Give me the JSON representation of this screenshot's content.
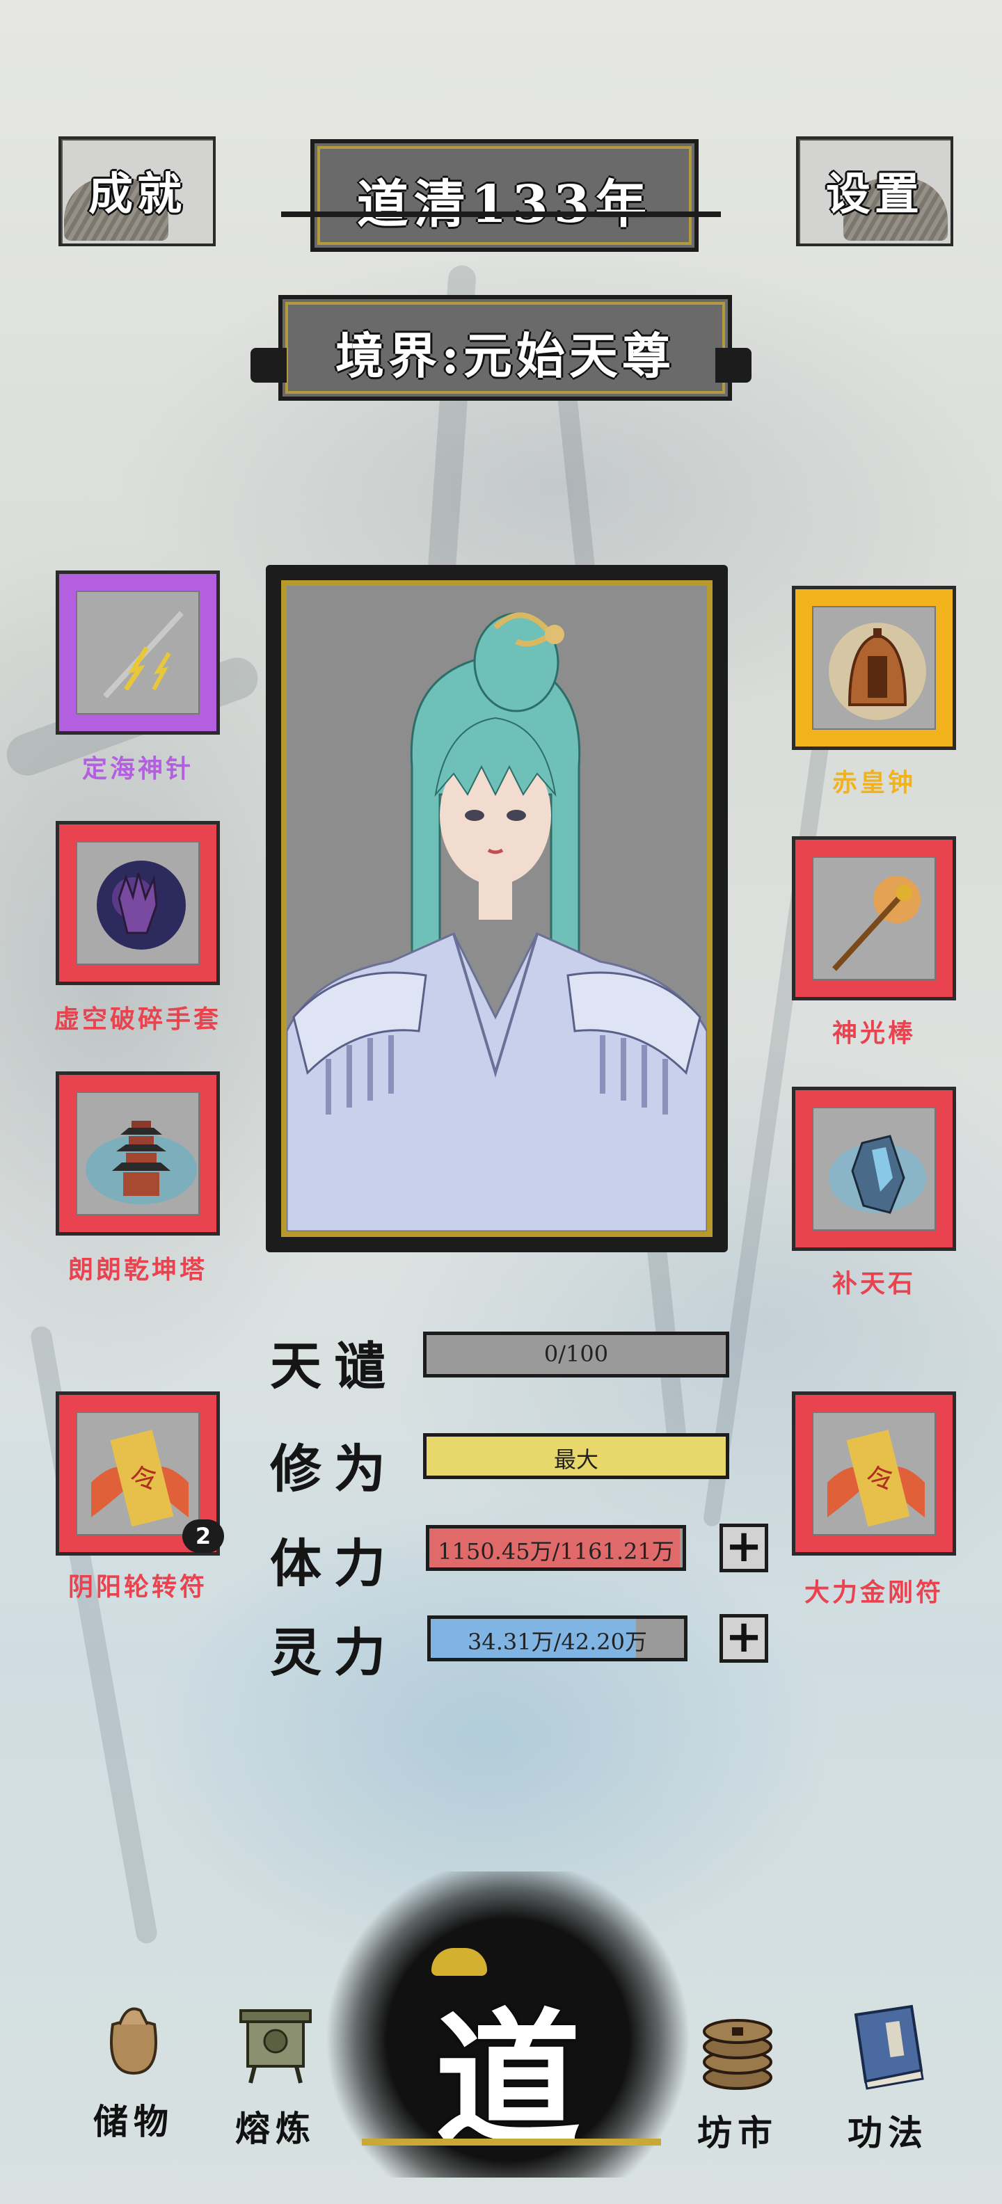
{
  "header": {
    "achievements_label": "成就",
    "era": "道清133年",
    "settings_label": "设置",
    "realm": "境界:元始天尊"
  },
  "equipment": {
    "left": [
      {
        "name": "定海神针",
        "rarity_color": "#b45ee0",
        "icon": "spear-icon"
      },
      {
        "name": "虚空破碎手套",
        "rarity_color": "#e8434f",
        "icon": "gauntlet-icon"
      },
      {
        "name": "朗朗乾坤塔",
        "rarity_color": "#e8434f",
        "icon": "pagoda-icon"
      },
      {
        "name": "阴阳轮转符",
        "rarity_color": "#e8434f",
        "icon": "talisman-icon",
        "count": "2"
      }
    ],
    "right": [
      {
        "name": "赤皇钟",
        "rarity_color": "#f2b21c",
        "icon": "bell-icon"
      },
      {
        "name": "神光棒",
        "rarity_color": "#e8434f",
        "icon": "staff-icon"
      },
      {
        "name": "补天石",
        "rarity_color": "#e8434f",
        "icon": "crystal-stone-icon"
      },
      {
        "name": "大力金刚符",
        "rarity_color": "#e8434f",
        "icon": "talisman-icon"
      }
    ]
  },
  "stats": {
    "tribulation": {
      "label": "天谴",
      "value": "0/100",
      "fraction": 0.0,
      "color": "#9a9a9a"
    },
    "cultivation": {
      "label": "修为",
      "value": "最大",
      "fraction": 1.0,
      "color": "#e8d76a"
    },
    "stamina": {
      "label": "体力",
      "value": "1150.45万/1161.21万",
      "fraction": 0.99,
      "color": "#e06a6a"
    },
    "spirit": {
      "label": "灵力",
      "value": "34.31万/42.20万",
      "fraction": 0.81,
      "color": "#7fb4e3"
    }
  },
  "nav": {
    "storage": "储物",
    "smelting": "熔炼",
    "dao": "道",
    "market": "坊市",
    "techniques": "功法"
  },
  "colors": {
    "legendary": "#f2b21c",
    "epic": "#b45ee0",
    "mythic": "#e8434f"
  }
}
